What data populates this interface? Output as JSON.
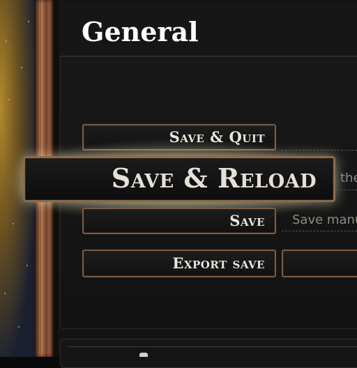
{
  "section": {
    "title": "General"
  },
  "buttons": {
    "save_quit": "Save & Quit",
    "save_reload": "Save & Reload",
    "save": "Save",
    "export_save": "Export save"
  },
  "descriptions": {
    "save_reload": "the",
    "save": "Save manu"
  },
  "colors": {
    "accent_border": "#7a5c46",
    "glow": "#fff3c8",
    "panel_bg": "#141414"
  }
}
